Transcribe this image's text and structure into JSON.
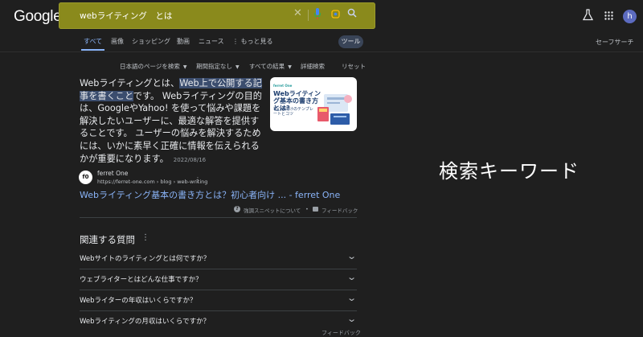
{
  "google_logo": "Google",
  "search": {
    "query": "webライティング　とは",
    "highlight_color": "#8a8a1c"
  },
  "header": {
    "avatar_letter": "h"
  },
  "tabs": [
    {
      "label": "すべて",
      "active": true
    },
    {
      "label": "画像"
    },
    {
      "label": "ショッピング"
    },
    {
      "label": "動画"
    },
    {
      "label": "ニュース"
    },
    {
      "label": "⋮ もっと見る"
    }
  ],
  "tools_label": "ツール",
  "safesearch_label": "セーフサーチ",
  "filters": [
    "日本語のページを検索",
    "期間指定なし",
    "すべての結果",
    "詳細検索",
    "リセット"
  ],
  "snippet": {
    "part1": "Webライティングとは、",
    "highlight": "Web上で公開する記事を書くこと",
    "part2": "です。 Webライティングの目的は、GoogleやYahoo! を使って悩みや課題を解決したいユーザーに、最適な解答を提供することです。 ユーザーの悩みを解決するためには、いかに素早く正確に情報を伝えられるかが重要になります。",
    "date": "2022/08/16",
    "thumbnail": {
      "brand": "ferret One",
      "title": "Webライティング基本の書き方とは?",
      "subtitle": "初心者向けのテンプレートとコツ"
    }
  },
  "result": {
    "favicon_text": "f0",
    "site_name": "ferret One",
    "url": "https://ferret-one.com › blog › web-writing",
    "title": "Webライティング基本の書き方とは？初心者向け ... - ferret One"
  },
  "featured_footer": {
    "about": "強調スニペットについて",
    "dot": "•",
    "feedback": "フィードバック"
  },
  "people_also_ask": {
    "title": "関連する質問",
    "questions": [
      "Webサイトのライティングとは何ですか？",
      "ウェブライターとはどんな仕事ですか？",
      "Webライターの年収はいくらですか？",
      "Webライティングの月収はいくらですか？"
    ],
    "feedback": "フィードバック"
  },
  "annotation_text": "検索キーワード"
}
